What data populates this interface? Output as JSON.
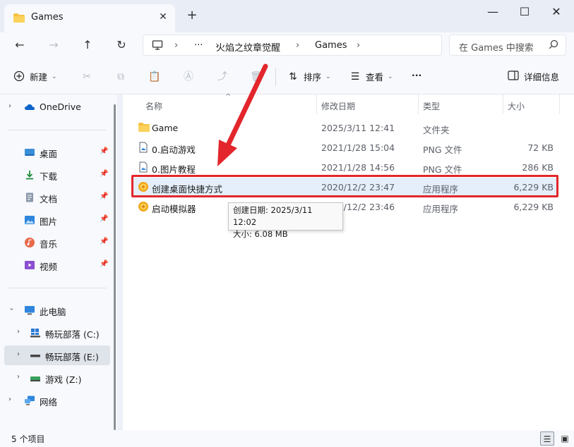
{
  "window": {
    "tab_title": "Games",
    "close_tab": "✕",
    "new_tab": "+",
    "minimize": "—",
    "maximize": "☐",
    "close": "✕"
  },
  "nav": {
    "back": "←",
    "forward": "→",
    "up": "↑",
    "refresh": "↻",
    "more": "···",
    "breadcrumb": [
      "火焰之纹章觉醒",
      "Games"
    ],
    "search_placeholder": "在 Games 中搜索"
  },
  "toolbar": {
    "new_label": "新建",
    "sort_label": "排序",
    "view_label": "查看",
    "more": "···",
    "details_label": "详细信息"
  },
  "sidebar": {
    "items": [
      {
        "label": "OneDrive"
      },
      {
        "label": "桌面"
      },
      {
        "label": "下载"
      },
      {
        "label": "文档"
      },
      {
        "label": "图片"
      },
      {
        "label": "音乐"
      },
      {
        "label": "视频"
      },
      {
        "label": "此电脑"
      },
      {
        "label": "畅玩部落 (C:)"
      },
      {
        "label": "畅玩部落 (E:)"
      },
      {
        "label": "游戏 (Z:)"
      },
      {
        "label": "网络"
      }
    ]
  },
  "columns": {
    "name": "名称",
    "date": "修改日期",
    "type": "类型",
    "size": "大小"
  },
  "files": [
    {
      "name": "Game",
      "date": "2025/3/11 12:41",
      "type": "文件夹",
      "size": "",
      "icon": "folder-icon"
    },
    {
      "name": "0.启动游戏",
      "date": "2021/1/28 15:04",
      "type": "PNG 文件",
      "size": "72 KB",
      "icon": "image-file-icon"
    },
    {
      "name": "0.图片教程",
      "date": "2021/1/28 14:56",
      "type": "PNG 文件",
      "size": "286 KB",
      "icon": "image-file-icon"
    },
    {
      "name": "创建桌面快捷方式",
      "date": "2020/12/2 23:47",
      "type": "应用程序",
      "size": "6,229 KB",
      "icon": "app-icon"
    },
    {
      "name": "启动模拟器",
      "date": "2020/12/2 23:46",
      "type": "应用程序",
      "size": "6,229 KB",
      "icon": "app-icon"
    }
  ],
  "tooltip": {
    "line1": "创建日期: 2025/3/11 12:02",
    "line2": "大小: 6.08 MB"
  },
  "status": {
    "count": "5 个项目"
  },
  "colors": {
    "highlight_box": "#e3262c",
    "accent": "#0067c0",
    "arrow": "#e3262c"
  }
}
